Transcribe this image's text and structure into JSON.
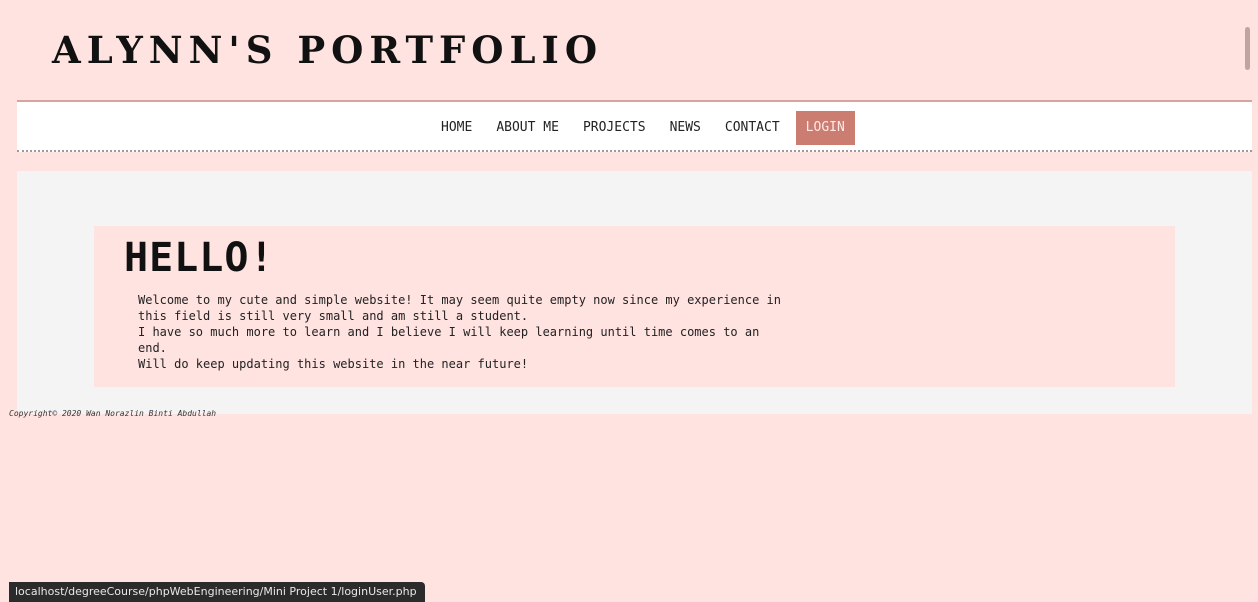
{
  "site": {
    "title": "ALYNN'S PORTFOLIO"
  },
  "nav": {
    "items": [
      {
        "label": "HOME"
      },
      {
        "label": "ABOUT ME"
      },
      {
        "label": "PROJECTS"
      },
      {
        "label": "NEWS"
      },
      {
        "label": "CONTACT"
      },
      {
        "label": "LOGIN"
      }
    ],
    "active_item": "LOGIN"
  },
  "main": {
    "heading": "HELLO!",
    "paragraph_lines": [
      "Welcome to my cute and simple website! It may seem quite empty now since my experience in",
      "this field is still very small and am still a student.",
      "I have so much more to learn and I believe I will keep learning until time comes to an",
      "end.",
      "Will do keep updating this website in the near future!"
    ]
  },
  "footer": {
    "copyright": "Copyright© 2020 Wan Norazlin Binti Abdullah"
  },
  "status_bar": {
    "url": "localhost/degreeCourse/phpWebEngineering/Mini Project 1/loginUser.php"
  },
  "colors": {
    "page_background": "#ffe3e1",
    "panel_background": "#f4f4f4",
    "nav_background": "#ffffff",
    "accent": "#cc7d72",
    "text": "#111111"
  }
}
